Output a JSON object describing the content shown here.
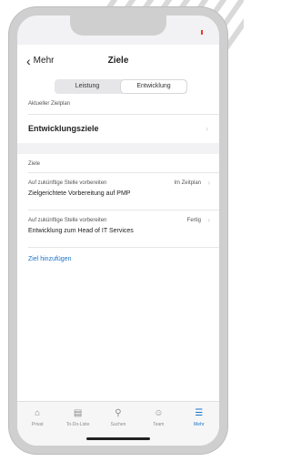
{
  "nav": {
    "back_label": "Mehr",
    "title": "Ziele"
  },
  "segments": [
    {
      "label": "Leistung",
      "active": false
    },
    {
      "label": "Entwicklung",
      "active": true
    }
  ],
  "current_plan": {
    "label": "Aktueller Zielplan",
    "item": "Entwicklungsziele"
  },
  "goals": {
    "section_label": "Ziele",
    "items": [
      {
        "category": "Auf zukünftige Stelle vorbereiten",
        "status": "Im Zeitplan",
        "title": "Zielgerichtete Vorbereitung auf PMP"
      },
      {
        "category": "Auf zukünftige Stelle vorbereiten",
        "status": "Fertig",
        "title": "Entwicklung zum Head of IT Services"
      }
    ],
    "add_link": "Ziel hinzufügen"
  },
  "tabbar": [
    {
      "label": "Privat",
      "icon": "home-icon"
    },
    {
      "label": "To-Do-Liste",
      "icon": "clipboard-icon"
    },
    {
      "label": "Suchen",
      "icon": "search-icon"
    },
    {
      "label": "Team",
      "icon": "team-icon"
    },
    {
      "label": "Mehr",
      "icon": "list-icon",
      "active": true
    }
  ],
  "colors": {
    "accent": "#1a73c8",
    "status_dot": "#e23b2e"
  }
}
